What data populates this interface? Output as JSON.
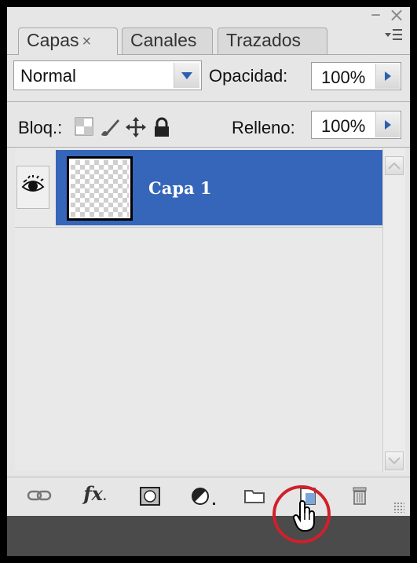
{
  "window": {
    "minimize_icon": "minimize-icon",
    "close_icon": "close-icon"
  },
  "tabs": [
    {
      "label": "Capas",
      "close": "×",
      "active": true
    },
    {
      "label": "Canales",
      "active": false
    },
    {
      "label": "Trazados",
      "active": false
    }
  ],
  "panel_menu_icon": "panel-menu-icon",
  "blend": {
    "value": "Normal"
  },
  "opacity": {
    "label": "Opacidad:",
    "value": "100%"
  },
  "lock": {
    "label": "Bloq.:",
    "icons": [
      "lock-transparent-pixels-icon",
      "lock-image-pixels-icon",
      "lock-position-icon",
      "lock-all-icon"
    ]
  },
  "fill": {
    "label": "Relleno:",
    "value": "100%"
  },
  "layers": [
    {
      "name": "Capa 1",
      "visible": true,
      "selected": true
    }
  ],
  "toolbar_icons": [
    "link-layers-icon",
    "layer-style-fx-icon",
    "layer-mask-icon",
    "adjustment-layer-icon",
    "new-group-icon",
    "new-layer-icon",
    "delete-layer-icon"
  ],
  "toolbar_fx": "fx",
  "colors": {
    "selection": "#3666b9",
    "panel": "#e6e6e6",
    "highlight_circle": "#d0202a",
    "arrow_blue": "#2d5fb0"
  }
}
